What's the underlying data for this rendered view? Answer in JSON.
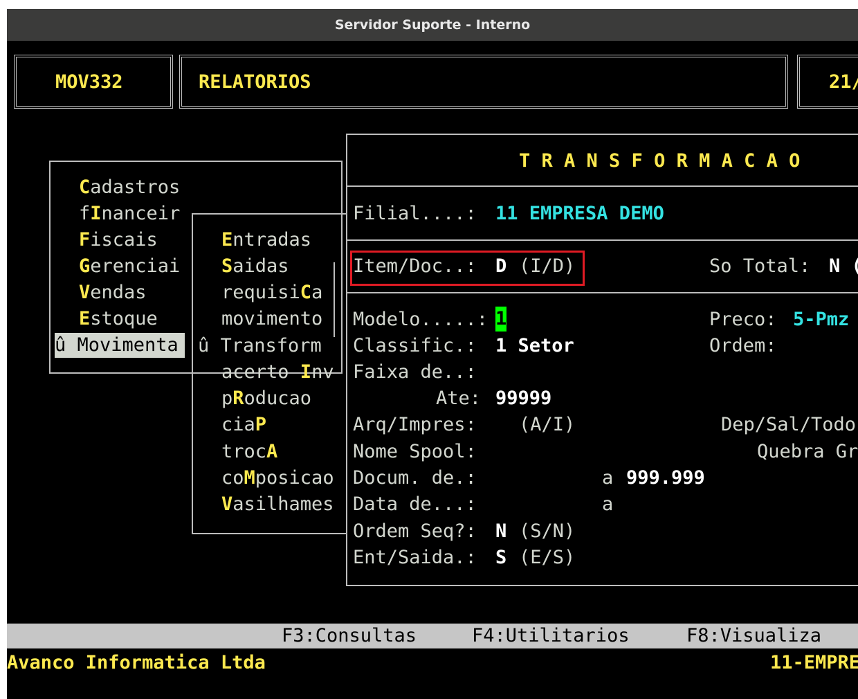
{
  "window": {
    "title": "Servidor Suporte - Interno"
  },
  "header": {
    "program_code": "MOV332",
    "section": "RELATORIOS",
    "date_partial": "21/"
  },
  "main_menu": {
    "items": [
      {
        "letter": "C",
        "rest": "adastros",
        "prefix": ""
      },
      {
        "prefix": "f",
        "letter": "I",
        "rest": "nanceir"
      },
      {
        "letter": "F",
        "rest": "iscais",
        "prefix": ""
      },
      {
        "letter": "G",
        "rest": "erenciai",
        "prefix": ""
      },
      {
        "letter": "V",
        "rest": "endas",
        "prefix": ""
      },
      {
        "letter": "E",
        "rest": "stoque",
        "prefix": ""
      }
    ],
    "selected": "û Movimenta"
  },
  "sub_menu": {
    "items": [
      {
        "letter": "E",
        "rest": "ntradas",
        "prefix": ""
      },
      {
        "letter": "S",
        "rest": "aidas",
        "prefix": ""
      },
      {
        "prefix": "requisi",
        "letter": "C",
        "rest": "a"
      },
      {
        "prefix": "movimento",
        "letter": "",
        "rest": ""
      },
      {
        "prefix": "û Transform",
        "letter": "",
        "rest": ""
      },
      {
        "prefix": "acerto ",
        "letter": "I",
        "rest": "nv"
      },
      {
        "prefix": "p",
        "letter": "R",
        "rest": "oducao"
      },
      {
        "prefix": "cia",
        "letter": "P",
        "rest": ""
      },
      {
        "prefix": "troc",
        "letter": "A",
        "rest": ""
      },
      {
        "prefix": "co",
        "letter": "M",
        "rest": "posicao"
      },
      {
        "letter": "V",
        "rest": "asilhames",
        "prefix": ""
      }
    ]
  },
  "form": {
    "title": "T R A N S F O R M A C A O",
    "filial_label": "Filial....:",
    "filial_value": "11 EMPRESA DEMO",
    "item_doc_label": "Item/Doc..:",
    "item_doc_value": "D",
    "item_doc_hint": "(I/D)",
    "so_total_label": "So Total:",
    "so_total_value": "N (",
    "modelo_label": "Modelo.....:",
    "modelo_value": "1",
    "preco_label": "Preco:",
    "preco_value": "5-Pmz",
    "classific_label": "Classific.:",
    "classific_value": "1 Setor",
    "ordem_label": "Ordem:",
    "faixa_label": "Faixa de..:",
    "ate_label": "Ate:",
    "ate_value": "99999",
    "arq_label": "Arq/Impres:",
    "arq_hint": "(A/I)",
    "dep_label": "Dep/Sal/Todo",
    "spool_label": "Nome Spool:",
    "quebra_label": "Quebra Gr",
    "docum_label": "Docum. de.:",
    "docum_a": "a",
    "docum_value": "999.999",
    "data_label": "Data de...:",
    "data_a": "a",
    "ordem_seq_label": "Ordem Seq?:",
    "ordem_seq_value": "N",
    "ordem_seq_hint": "(S/N)",
    "ent_saida_label": "Ent/Saida.:",
    "ent_saida_value": "S",
    "ent_saida_hint": "(E/S)"
  },
  "function_keys": {
    "f3": "F3:Consultas",
    "f4": "F4:Utilitarios",
    "f8": "F8:Visualiza"
  },
  "footer": {
    "company": "Avanco Informatica Ltda",
    "branch": "11-EMPRE"
  },
  "colors": {
    "yellow": "#fce94f",
    "cyan": "#34e2e2",
    "cursor": "#00ff00",
    "highlight": "#e01b24"
  }
}
